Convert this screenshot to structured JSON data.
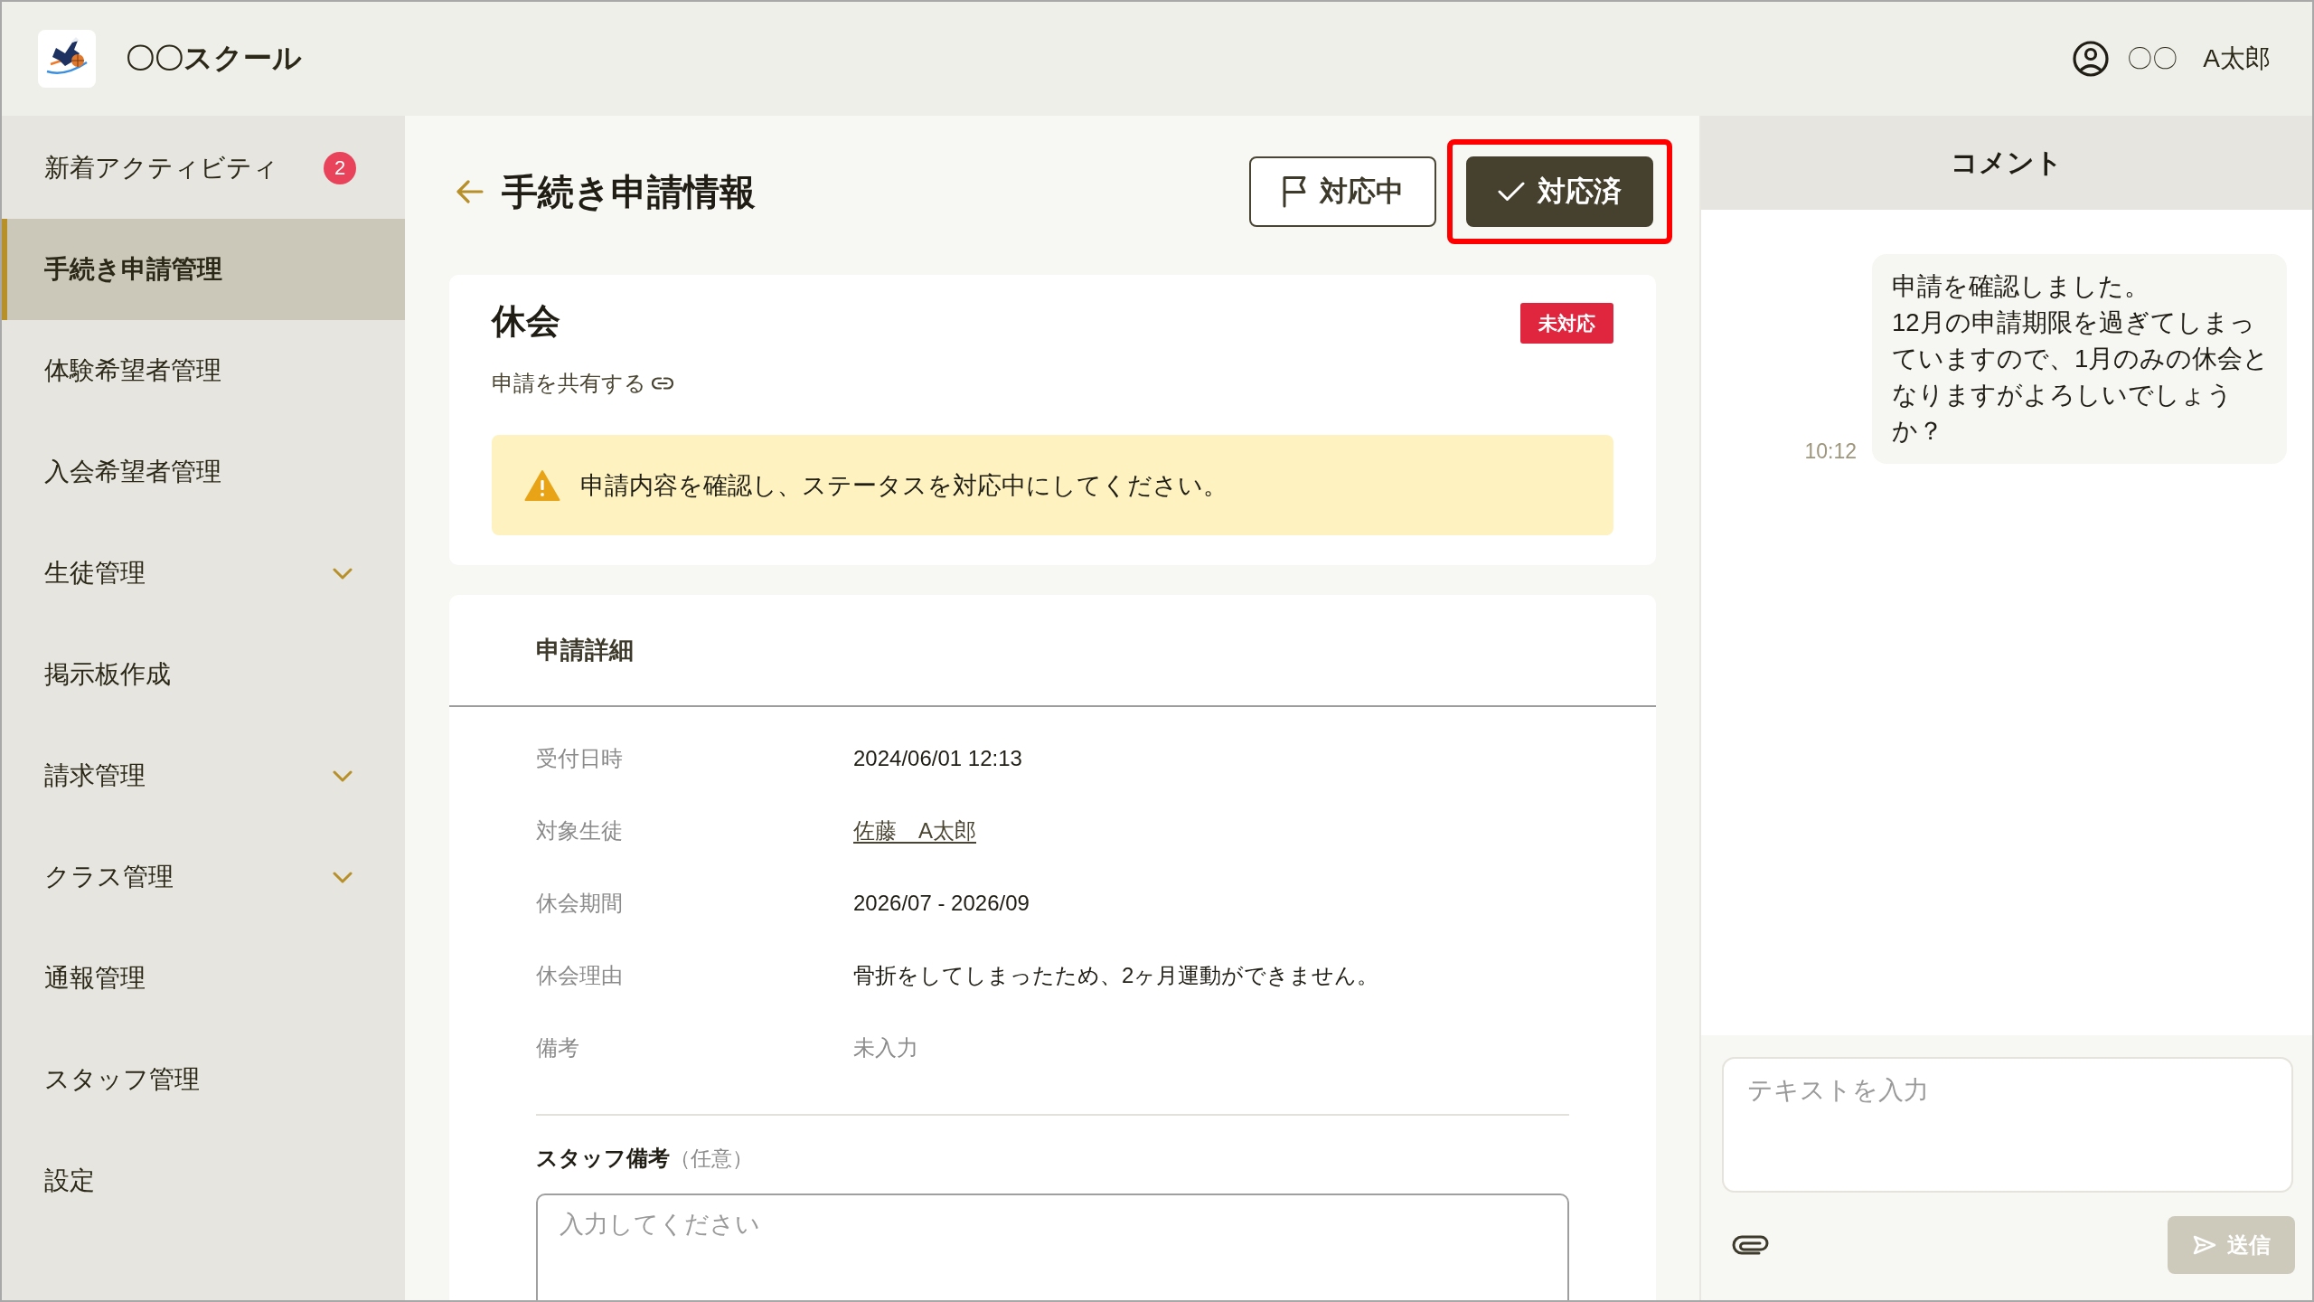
{
  "header": {
    "school_name": "〇〇スクール",
    "user": {
      "family_name": "〇〇",
      "given_name": "A太郎"
    }
  },
  "sidebar": {
    "items": [
      {
        "label": "新着アクティビティ",
        "badge": "2",
        "selected": false,
        "has_submenu": false
      },
      {
        "label": "手続き申請管理",
        "selected": true,
        "has_submenu": false
      },
      {
        "label": "体験希望者管理",
        "selected": false,
        "has_submenu": false
      },
      {
        "label": "入会希望者管理",
        "selected": false,
        "has_submenu": false
      },
      {
        "label": "生徒管理",
        "selected": false,
        "has_submenu": true
      },
      {
        "label": "掲示板作成",
        "selected": false,
        "has_submenu": false
      },
      {
        "label": "請求管理",
        "selected": false,
        "has_submenu": true
      },
      {
        "label": "クラス管理",
        "selected": false,
        "has_submenu": true
      },
      {
        "label": "通報管理",
        "selected": false,
        "has_submenu": false
      },
      {
        "label": "スタッフ管理",
        "selected": false,
        "has_submenu": false
      },
      {
        "label": "設定",
        "selected": false,
        "has_submenu": false
      }
    ]
  },
  "page": {
    "title": "手続き申請情報",
    "actions": [
      {
        "kind": "outline",
        "label": "対応中",
        "highlighted": false
      },
      {
        "kind": "filled",
        "label": "対応済",
        "highlighted": true
      }
    ]
  },
  "application": {
    "title": "休会",
    "status": "未対応",
    "share_link": "申請を共有する",
    "alert": "申請内容を確認し、ステータスを対応中にしてください。"
  },
  "details": {
    "heading": "申請詳細",
    "rows": [
      {
        "kind": "text",
        "label": "受付日時",
        "value": "2024/06/01 12:13"
      },
      {
        "kind": "link",
        "label": "対象生徒",
        "value": "佐藤　A太郎"
      },
      {
        "kind": "text",
        "label": "休会期間",
        "value": "2026/07 - 2026/09"
      },
      {
        "kind": "text",
        "label": "休会理由",
        "value": "骨折をしてしまったため、2ヶ月運動ができません。"
      },
      {
        "kind": "empty",
        "label": "備考",
        "value": "未入力"
      }
    ]
  },
  "staff_note": {
    "label": "スタッフ備考",
    "hint": "（任意）",
    "placeholder": "入力してください"
  },
  "comments": {
    "title": "コメント",
    "messages": [
      {
        "time": "10:12",
        "text": "申請を確認しました。\n12月の申請期限を過ぎてしまっていますので、1月のみの休会となりますがよろしいでしょうか？"
      }
    ],
    "input": {
      "placeholder": "テキストを入力"
    },
    "send": {
      "label": "送信",
      "disabled": true
    }
  }
}
